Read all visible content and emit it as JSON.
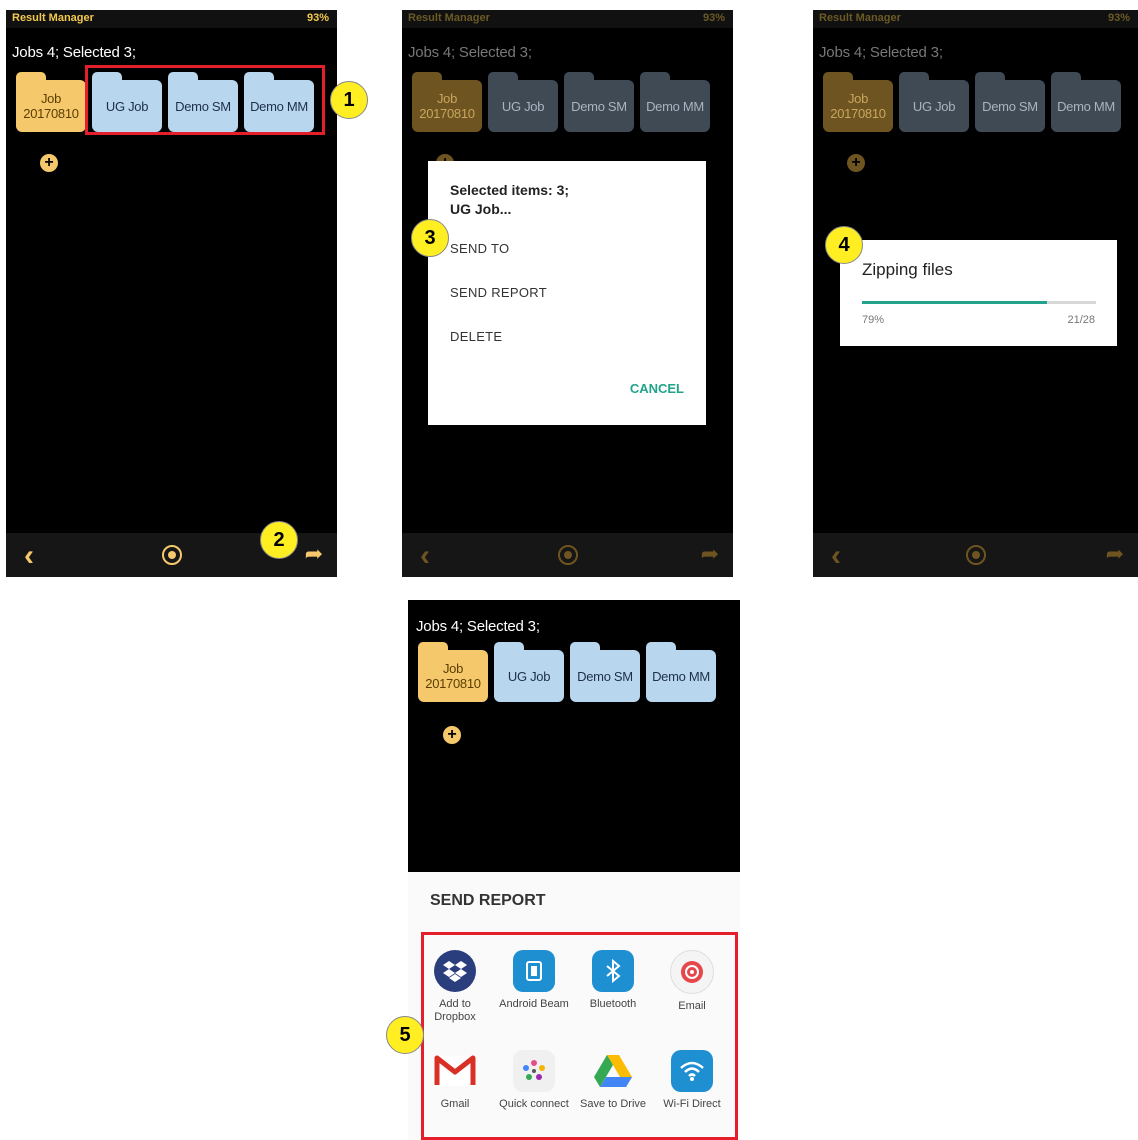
{
  "status": {
    "app_name": "Result Manager",
    "battery": "93%"
  },
  "header": "Jobs 4; Selected 3;",
  "folders": [
    {
      "label": "Job 20170810",
      "color": "#f6c86c"
    },
    {
      "label": "UG Job",
      "color": "#b8d6ee"
    },
    {
      "label": "Demo SM",
      "color": "#b8d6ee"
    },
    {
      "label": "Demo MM",
      "color": "#b8d6ee"
    }
  ],
  "icons": {
    "add": "+",
    "back": "‹",
    "home": "◉",
    "share": "➦"
  },
  "callouts": [
    "1",
    "2",
    "3",
    "4",
    "5"
  ],
  "dialog": {
    "title_line1": "Selected items: 3;",
    "title_line2": "UG Job...",
    "items": [
      "SEND TO",
      "SEND REPORT",
      "DELETE"
    ],
    "cancel": "CANCEL"
  },
  "zip": {
    "title": "Zipping files",
    "percent": "79%",
    "count": "21/28",
    "progress": 0.79
  },
  "share": {
    "title": "SEND REPORT",
    "apps": [
      {
        "label": "Add to Dropbox",
        "icon": "dropbox-icon",
        "color": "#2a3d7c"
      },
      {
        "label": "Android Beam",
        "icon": "android-beam-icon",
        "color": "#1e8fd1"
      },
      {
        "label": "Bluetooth",
        "icon": "bluetooth-icon",
        "color": "#1e8fd1"
      },
      {
        "label": "Email",
        "icon": "email-icon",
        "color": "#e5474b"
      },
      {
        "label": "Gmail",
        "icon": "gmail-icon",
        "color": "#d93025"
      },
      {
        "label": "Quick connect",
        "icon": "quick-connect-icon",
        "color": "#f0f0f0"
      },
      {
        "label": "Save to Drive",
        "icon": "drive-icon",
        "color": "#34a853"
      },
      {
        "label": "Wi-Fi Direct",
        "icon": "wifi-direct-icon",
        "color": "#1e8fd1"
      }
    ]
  }
}
